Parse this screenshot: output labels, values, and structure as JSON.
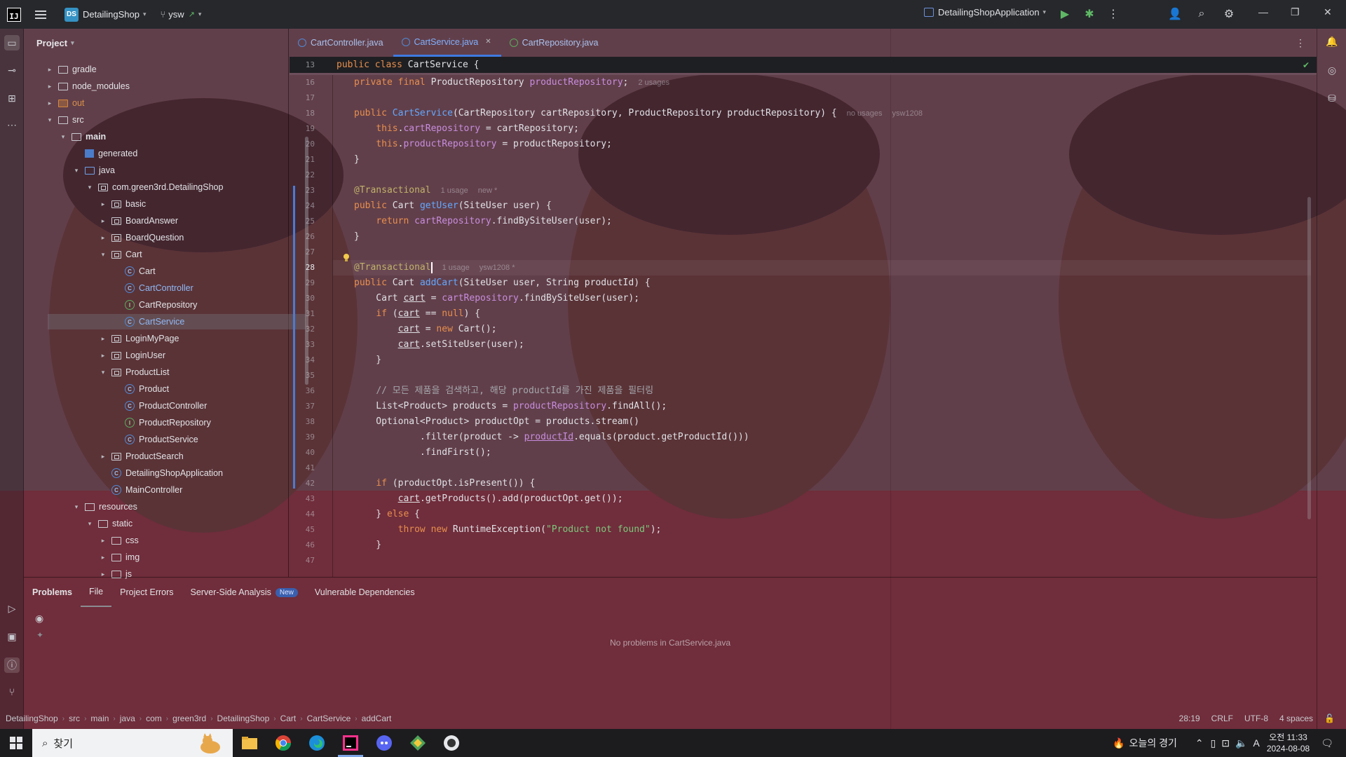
{
  "titlebar": {
    "logo": "IJ",
    "project_badge": "DS",
    "project_name": "DetailingShop",
    "branch": "ysw",
    "run_config": "DetailingShopApplication"
  },
  "project_panel": {
    "title": "Project",
    "tree": [
      {
        "label": "gradle",
        "type": "folder",
        "arrow": "right"
      },
      {
        "label": "node_modules",
        "type": "folder",
        "arrow": "right"
      },
      {
        "label": "out",
        "type": "folder-orange",
        "arrow": "right"
      },
      {
        "label": "src",
        "type": "folder",
        "arrow": "down"
      },
      {
        "label": "main",
        "type": "folder",
        "arrow": "down"
      },
      {
        "label": "generated",
        "type": "gen",
        "arrow": ""
      },
      {
        "label": "java",
        "type": "folder-blue",
        "arrow": "down"
      },
      {
        "label": "com.green3rd.DetailingShop",
        "type": "package",
        "arrow": "down"
      },
      {
        "label": "basic",
        "type": "package",
        "arrow": "right"
      },
      {
        "label": "BoardAnswer",
        "type": "package",
        "arrow": "right"
      },
      {
        "label": "BoardQuestion",
        "type": "package",
        "arrow": "right"
      },
      {
        "label": "Cart",
        "type": "package",
        "arrow": "down"
      },
      {
        "label": "Cart",
        "type": "class",
        "arrow": ""
      },
      {
        "label": "CartController",
        "type": "class",
        "arrow": ""
      },
      {
        "label": "CartRepository",
        "type": "interface",
        "arrow": ""
      },
      {
        "label": "CartService",
        "type": "class",
        "arrow": ""
      },
      {
        "label": "LoginMyPage",
        "type": "package",
        "arrow": "right"
      },
      {
        "label": "LoginUser",
        "type": "package",
        "arrow": "right"
      },
      {
        "label": "ProductList",
        "type": "package",
        "arrow": "down"
      },
      {
        "label": "Product",
        "type": "class",
        "arrow": ""
      },
      {
        "label": "ProductController",
        "type": "class",
        "arrow": ""
      },
      {
        "label": "ProductRepository",
        "type": "interface",
        "arrow": ""
      },
      {
        "label": "ProductService",
        "type": "class",
        "arrow": ""
      },
      {
        "label": "ProductSearch",
        "type": "package",
        "arrow": "right"
      },
      {
        "label": "DetailingShopApplication",
        "type": "class",
        "arrow": ""
      },
      {
        "label": "MainController",
        "type": "class",
        "arrow": ""
      },
      {
        "label": "resources",
        "type": "res",
        "arrow": "down"
      },
      {
        "label": "static",
        "type": "folder",
        "arrow": "down"
      },
      {
        "label": "css",
        "type": "folder",
        "arrow": "right"
      },
      {
        "label": "img",
        "type": "folder",
        "arrow": "right"
      },
      {
        "label": "js",
        "type": "folder",
        "arrow": "right"
      }
    ]
  },
  "editor": {
    "tabs": [
      {
        "label": "CartController.java",
        "icon": "class"
      },
      {
        "label": "CartService.java",
        "icon": "class"
      },
      {
        "label": "CartRepository.java",
        "icon": "interface"
      }
    ],
    "sticky_line_no": "13",
    "sticky_code": "public class CartService {",
    "line_numbers": [
      "16",
      "17",
      "18",
      "19",
      "20",
      "21",
      "22",
      "23",
      "24",
      "25",
      "26",
      "27",
      "28",
      "29",
      "30",
      "31",
      "32",
      "33",
      "34",
      "35",
      "36",
      "37",
      "38",
      "39",
      "40",
      "41",
      "42",
      "43",
      "44",
      "45",
      "46",
      "47"
    ],
    "current_line": "28",
    "hints": {
      "usages_2": "2 usages",
      "no_usages": "no usages",
      "author": "ysw1208",
      "one_usage": "1 usage",
      "new": "new *",
      "author_star": "ysw1208 *"
    },
    "comment_text": "// 모든 제품을 검색하고, 해당 productId를 가진 제품을 필터링",
    "exception_msg": "\"Product not found\""
  },
  "problems": {
    "tabs": [
      "Problems",
      "File",
      "Project Errors",
      "Server-Side Analysis",
      "Vulnerable Dependencies"
    ],
    "new_badge": "New",
    "empty_message": "No problems in CartService.java"
  },
  "statusbar": {
    "breadcrumbs": [
      "DetailingShop",
      "src",
      "main",
      "java",
      "com",
      "green3rd",
      "DetailingShop",
      "Cart",
      "CartService",
      "addCart"
    ],
    "position": "28:19",
    "line_sep": "CRLF",
    "encoding": "UTF-8",
    "indent": "4 spaces"
  },
  "taskbar": {
    "search_placeholder": "찾기",
    "weather": "오늘의 경기",
    "time": "오전 11:33",
    "date": "2024-08-08",
    "ime": "A"
  },
  "colors": {
    "accent": "#3f7ae0",
    "background_tint": "#6e3a42",
    "titlebar": "#26282c"
  }
}
